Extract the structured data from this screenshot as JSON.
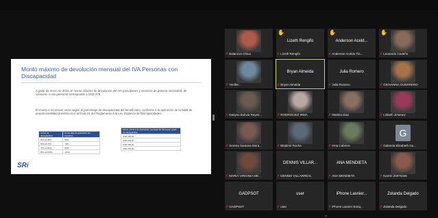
{
  "topbar": {
    "label": ""
  },
  "slide": {
    "title": "Monto máximo de devolución mensual del IVA Personas con Discapacidad",
    "paragraph1": "A partir de enero de 2022, el monto máximo de devolución del IVA para bienes y servicios de primera necesidad, de consumo o uso personal corresponde a USD 378.",
    "paragraph2": "El monto a reconocer varía según el porcentaje de discapacidad del beneficiario, conforme a la aplicación de la tabla de proporcionalidad prevista en el artículo 21 del Reglamento a la Ley Orgánica de Discapacidades.",
    "table1_headers": [
      "Grado de discapacidad",
      "Porcentaje de aplicación del beneficio"
    ],
    "table1_rows": [
      [
        "30% al 49%",
        "60%"
      ],
      [
        "50% al 74%",
        "70%"
      ],
      [
        "75% al 84%",
        "80%"
      ],
      [
        "85% al 100%",
        "100%"
      ]
    ],
    "table2_header": "Monto máximo de devolución mensual del IVA según grado de discapacidad",
    "table2_rows": [
      "USD 225,00",
      "USD 262,50",
      "USD 300,00",
      "USD 375,00"
    ],
    "logo": "SRi"
  },
  "participants": [
    {
      "display": "photo",
      "caption": "Balanzon Chica",
      "hand": false,
      "photo_color": "#b05a4a"
    },
    {
      "display": "name",
      "name": "Lizeth Rengifo",
      "caption": "Lizeth Rengifo",
      "hand": true
    },
    {
      "display": "name",
      "name": "Anderson Aceld...",
      "caption": "Anderson Aceldo Tin...",
      "hand": true
    },
    {
      "display": "photo",
      "caption": "Leonardo Cedeño",
      "hand": true,
      "photo_color": "#8a6a58"
    },
    {
      "display": "photo",
      "caption": "Yenifer...",
      "hand": false,
      "photo_color": "#6e8aa0"
    },
    {
      "display": "name",
      "name": "Bryan Almeida",
      "caption": "Bryan Almeida",
      "hand": false,
      "highlight": true
    },
    {
      "display": "name",
      "name": "Julia Romero",
      "caption": "Julia Romero",
      "hand": false
    },
    {
      "display": "photo",
      "caption": "GIOVANNA GUERRERO",
      "hand": false,
      "photo_color": "#a6724a"
    },
    {
      "display": "photo",
      "caption": "Danyes Bolivar Reyes...",
      "hand": false,
      "photo_color": "#6a5a50"
    },
    {
      "display": "photo",
      "caption": "RODRIGUEZ IRMA",
      "hand": false,
      "photo_color": "#b9a9a0"
    },
    {
      "display": "photo",
      "caption": "Maritza Diaz",
      "hand": false,
      "photo_color": "#8a6f5e"
    },
    {
      "display": "photo",
      "caption": "Lisbeth Jimenez",
      "hand": false,
      "photo_color": "#9a3a5a"
    },
    {
      "display": "photo",
      "caption": "Serena Santana Mora...",
      "hand": false,
      "photo_color": "#7a5a4e"
    },
    {
      "display": "photo",
      "caption": "Bladimir Rocha",
      "hand": false,
      "photo_color": "#5a6a78"
    },
    {
      "display": "photo",
      "caption": "Irma Cabrera",
      "hand": false,
      "photo_color": "#6a7a5a"
    },
    {
      "display": "avatar",
      "letter": "G",
      "caption": "Gabriela Elizabeth Gu...",
      "hand": false
    },
    {
      "display": "photo",
      "caption": "MARIA VIRGINIA ME...",
      "hand": false,
      "photo_color": "#6e4a3a"
    },
    {
      "display": "name",
      "name": "DENNIS VILLAR...",
      "caption": "DENNIS VILLARREAL",
      "hand": false
    },
    {
      "display": "name",
      "name": "ANA MENDIETA",
      "caption": "ANA MENDIETA",
      "hand": false
    },
    {
      "display": "photo",
      "caption": "Karem 25975336",
      "hand": false,
      "photo_color": "#8a5a4a"
    },
    {
      "display": "name",
      "name": "GADPSOT",
      "caption": "GADPSOT",
      "hand": false
    },
    {
      "display": "name",
      "name": "user",
      "caption": "user",
      "hand": false
    },
    {
      "display": "name",
      "name": "iPhone Lasnier...",
      "caption": "iPhone Lasnier Enriq...",
      "hand": false
    },
    {
      "display": "name",
      "name": "Zolanda Delgado",
      "caption": "Zolanda Delgado",
      "hand": false
    }
  ]
}
